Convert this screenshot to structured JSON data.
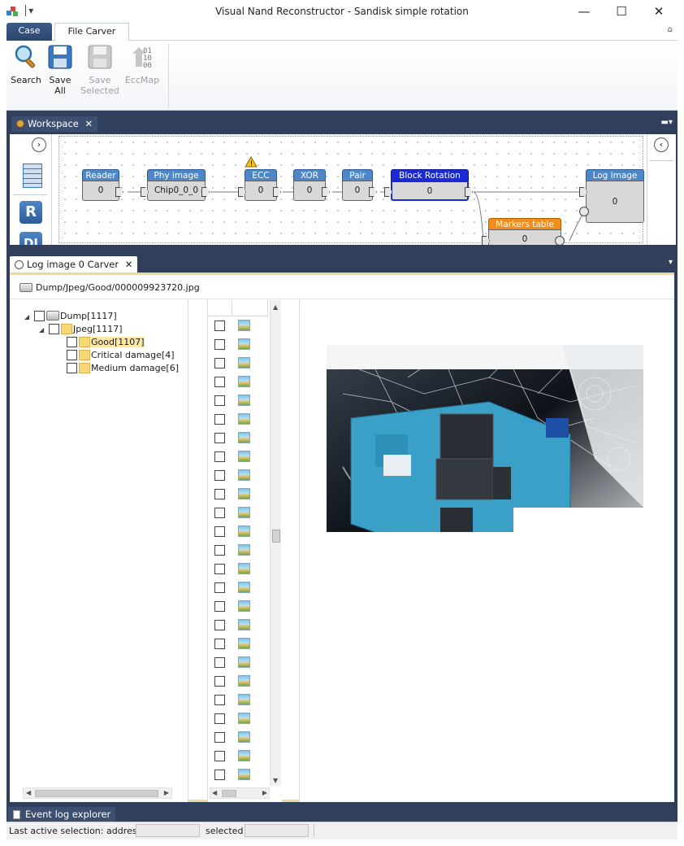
{
  "window": {
    "title": "Visual Nand Reconstructor - Sandisk simple rotation",
    "minimize": "—",
    "maximize": "☐",
    "close": "✕"
  },
  "ribbon": {
    "tabs": [
      {
        "label": "Case",
        "active": false
      },
      {
        "label": "File Carver",
        "active": true
      }
    ],
    "buttons": [
      {
        "label": "Search",
        "icon": "search-icon",
        "enabled": true
      },
      {
        "label": "Save\nAll",
        "icon": "save-all-icon",
        "enabled": true
      },
      {
        "label": "Save\nSelected",
        "icon": "save-selected-icon",
        "enabled": false
      },
      {
        "label": "EccMap",
        "icon": "eccmap-icon",
        "enabled": false
      }
    ]
  },
  "workspace": {
    "tab_label": "Workspace",
    "nodes": [
      {
        "title": "Reader",
        "value": "0"
      },
      {
        "title": "Phy image",
        "value": "Chip0_0_0"
      },
      {
        "title": "ECC",
        "value": "0",
        "warning": true
      },
      {
        "title": "XOR",
        "value": "0"
      },
      {
        "title": "Pair",
        "value": "0"
      },
      {
        "title": "Block Rotation",
        "value": "0",
        "selected": true
      },
      {
        "title": "Log image",
        "value": "0"
      },
      {
        "title": "Markers table",
        "value": "0"
      }
    ],
    "side_tools": [
      "R",
      "DI"
    ]
  },
  "carver": {
    "tab_label": "Log image 0 Carver",
    "path": "Dump/Jpeg/Good/000009923720.jpg",
    "tree": {
      "root": "Dump[1117]",
      "jpeg": "Jpeg[1117]",
      "children": [
        "Good[1107]",
        "Critical damage[4]",
        "Medium damage[6]"
      ]
    },
    "file_rows": 25
  },
  "event_log": {
    "label": "Event log explorer"
  },
  "status": {
    "last_active": "Last active selection:  address",
    "selected": "selected",
    "address_value": "",
    "selected_value": ""
  },
  "colors": {
    "frame": "#2f3f5c",
    "node_header": "#4f86c6",
    "node_selected": "#1a2bd6",
    "markers_header": "#f28c1a",
    "highlight": "#f3d996"
  }
}
